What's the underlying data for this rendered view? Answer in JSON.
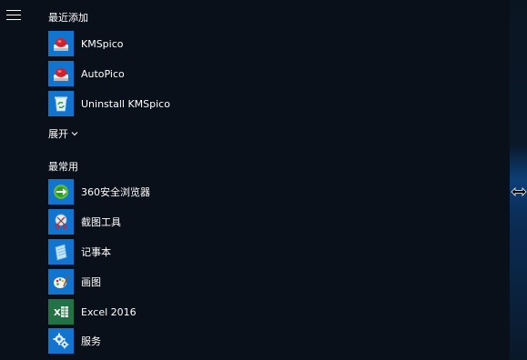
{
  "start_menu": {
    "recently_added_header": "最近添加",
    "recent_items": [
      {
        "label": "KMSpico",
        "icon": "kmspico-icon"
      },
      {
        "label": "AutoPico",
        "icon": "autopico-icon"
      },
      {
        "label": "Uninstall KMSpico",
        "icon": "recycle-bin-icon"
      }
    ],
    "expand_label": "展开",
    "most_used_header": "最常用",
    "most_used_items": [
      {
        "label": "360安全浏览器",
        "icon": "360-browser-icon"
      },
      {
        "label": "截图工具",
        "icon": "snipping-tool-icon"
      },
      {
        "label": "记事本",
        "icon": "notepad-icon"
      },
      {
        "label": "画图",
        "icon": "paint-icon"
      },
      {
        "label": "Excel 2016",
        "icon": "excel-icon"
      },
      {
        "label": "服务",
        "icon": "services-gear-icon"
      }
    ]
  },
  "colors": {
    "tile_blue": "#1174cf",
    "excel_green": "#217346",
    "panel_bg": "#0a111a"
  }
}
